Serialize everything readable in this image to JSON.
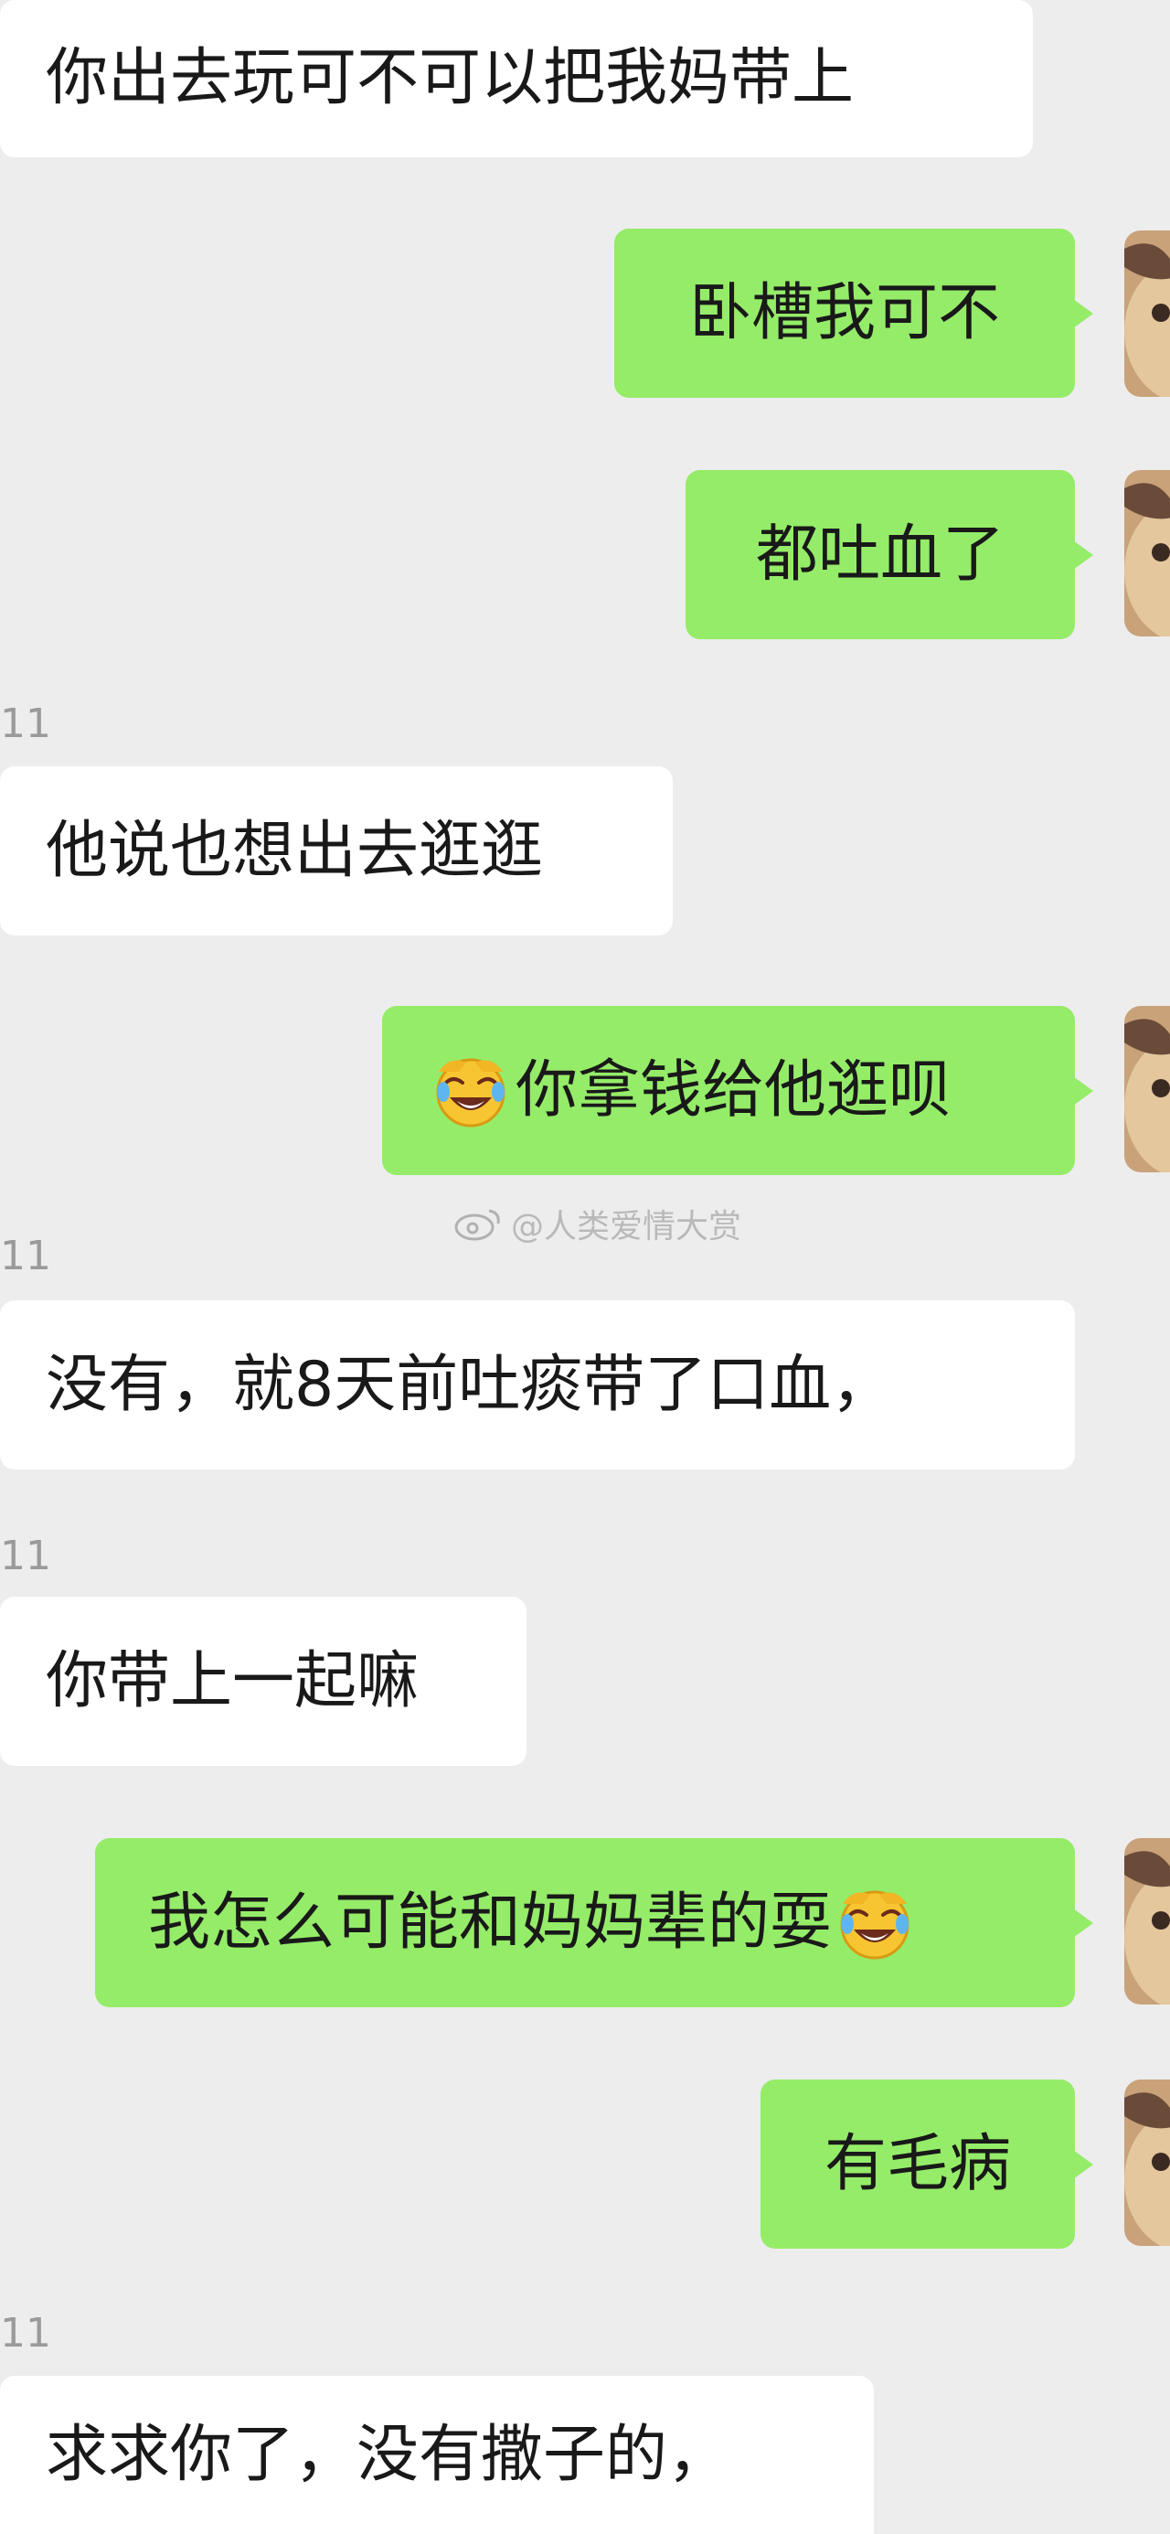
{
  "colors": {
    "background": "#ededed",
    "incoming_bubble": "#ffffff",
    "outgoing_bubble": "#95ec69",
    "text": "#191919",
    "sender_label": "#9a9a9a"
  },
  "watermark": {
    "icon": "weibo-logo-icon",
    "text": "@人类爱情大赏"
  },
  "messages": [
    {
      "side": "in",
      "text": "你出去玩可不可以把我妈带上"
    },
    {
      "side": "out",
      "text": "卧槽我可不"
    },
    {
      "side": "out",
      "text": "都吐血了"
    },
    {
      "side": "in",
      "sender": "11",
      "text": "他说也想出去逛逛"
    },
    {
      "side": "out",
      "emoji": "rolling-laughing-emoji",
      "text": "你拿钱给他逛呗"
    },
    {
      "side": "in",
      "sender": "11",
      "text": "没有，就8天前吐痰带了口血，"
    },
    {
      "side": "in",
      "sender": "11",
      "text": "你带上一起嘛"
    },
    {
      "side": "out",
      "text": "我怎么可能和妈妈辈的耍",
      "emoji_after": "rolling-laughing-emoji"
    },
    {
      "side": "out",
      "text": "有毛病"
    },
    {
      "side": "in",
      "sender": "11",
      "text": "求求你了，没有撒子的，"
    }
  ]
}
